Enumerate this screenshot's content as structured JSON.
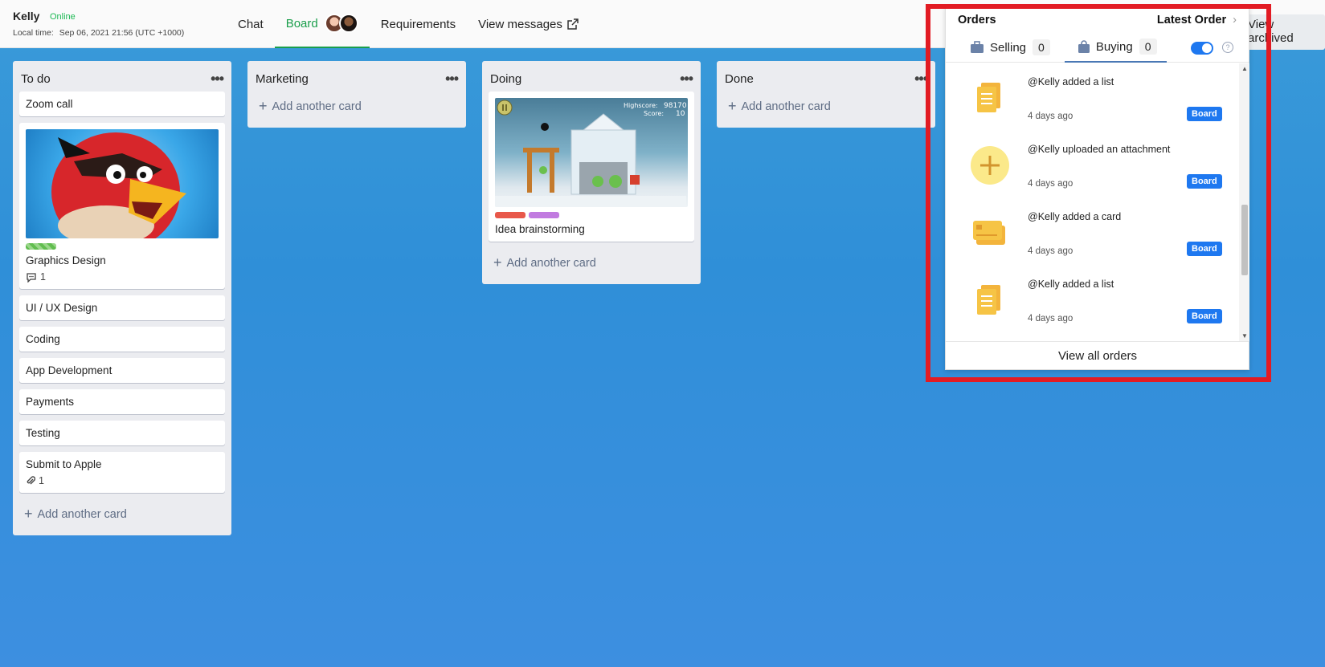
{
  "header": {
    "user_name": "Kelly",
    "status": "Online",
    "local_time_label": "Local time:",
    "local_time_value": "Sep 06, 2021 21:56 (UTC +1000)",
    "nav": {
      "chat": "Chat",
      "board": "Board",
      "requirements": "Requirements",
      "view_messages": "View messages"
    },
    "view_archived": "View archived"
  },
  "lists": {
    "todo": {
      "title": "To do",
      "cards": {
        "zoom": "Zoom call",
        "graphics": "Graphics Design",
        "graphics_comments": "1",
        "uiux": "UI / UX Design",
        "coding": "Coding",
        "appdev": "App Development",
        "payments": "Payments",
        "testing": "Testing",
        "submit": "Submit to Apple",
        "submit_attachments": "1"
      },
      "add": "Add another card"
    },
    "marketing": {
      "title": "Marketing",
      "add": "Add another card"
    },
    "doing": {
      "title": "Doing",
      "cards": {
        "idea": "Idea brainstorming"
      },
      "game_highscore_label": "Highscore:",
      "game_highscore": "98170",
      "game_score_label": "Score:",
      "game_score": "10",
      "add": "Add another card"
    },
    "done": {
      "title": "Done",
      "add": "Add another card"
    }
  },
  "orders": {
    "title": "Orders",
    "latest_order": "Latest Order",
    "tabs": {
      "selling": "Selling",
      "selling_count": "0",
      "buying": "Buying",
      "buying_count": "0"
    },
    "items": [
      {
        "text": "@Kelly added a list",
        "time": "4 days ago",
        "badge": "Board",
        "icon": "list-doc-icon"
      },
      {
        "text": "@Kelly uploaded an attachment",
        "time": "4 days ago",
        "badge": "Board",
        "icon": "plus-circle-icon"
      },
      {
        "text": "@Kelly added a card",
        "time": "4 days ago",
        "badge": "Board",
        "icon": "card-icon"
      },
      {
        "text": "@Kelly added a list",
        "time": "4 days ago",
        "badge": "Board",
        "icon": "list-doc-icon"
      }
    ],
    "view_all": "View all orders"
  },
  "colors": {
    "accent_green": "#1a9e4b",
    "badge_blue": "#1e78f0",
    "highlight_red": "#e21b23",
    "icon_yellow": "#f6c445"
  }
}
